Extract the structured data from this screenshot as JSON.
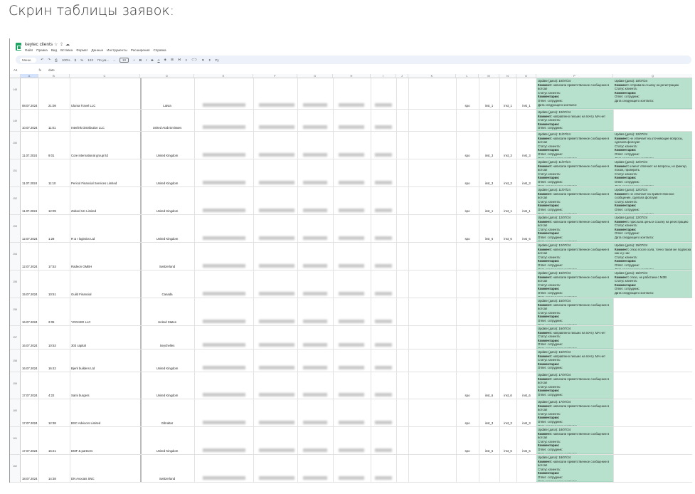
{
  "heading": "Скрин таблицы заявок:",
  "app": {
    "title": "keytec clients",
    "icons": [
      "star-icon",
      "move-icon",
      "cloud-icon"
    ],
    "menu": [
      "Файл",
      "Правка",
      "Вид",
      "Вставка",
      "Формат",
      "Данные",
      "Инструменты",
      "Расширения",
      "Справка"
    ],
    "toolbar": {
      "search": "Меню",
      "zoom": "100%",
      "number_format": "123",
      "font": "По ум...",
      "font_size": "10"
    },
    "name_box": "A1",
    "formula": "date"
  },
  "columns": [
    "A",
    "B",
    "C",
    "D",
    "E",
    "F",
    "G",
    "H",
    "I",
    "J",
    "K",
    "L",
    "M",
    "N",
    "O",
    "P",
    "Q"
  ],
  "labels": {
    "update": "Update (дата):",
    "comment": "Коммент:",
    "status": "Статус клиента:",
    "comments": "Комментарии:",
    "resp": "Ответ. сотрудник:",
    "next": "Дата следующего контакта:"
  },
  "rows": [
    {
      "n": "148",
      "date": "08.07.2024",
      "time": "21:08",
      "company": "Ulama Travel LLC",
      "country": "Latvia",
      "l": [
        "spo",
        "inst_1",
        "inst_1",
        "inst_1"
      ],
      "p": {
        "d": "10/07/24",
        "c": "написали приветственное сообщение в вотсап"
      },
      "q": {
        "d": "10/07/24",
        "c": "отправила ссылку на регистрацию"
      }
    },
    {
      "n": "149",
      "date": "10.07.2024",
      "time": "11:01",
      "company": "Interlink Distribution LLC",
      "country": "United Arab Emirates",
      "l": null,
      "p": {
        "d": "10/07/24",
        "c": "направлено письмо на почту. МА нет"
      },
      "q": null
    },
    {
      "n": "150",
      "date": "11.07.2024",
      "time": "9:01",
      "company": "Core international group ltd",
      "country": "United Kingdom",
      "l": [
        "spo",
        "inst_3",
        "inst_3",
        "inst_3"
      ],
      "p": {
        "d": "11/07/24",
        "c": "написали приветственное сообщение в вотсап"
      },
      "q": {
        "d": "12/07/24",
        "c": "не отвечает на уточняющие вопросы, сделала фолоуап"
      }
    },
    {
      "n": "151",
      "date": "11.07.2024",
      "time": "11:10",
      "company": "Pericol Financial Services Limited",
      "country": "United Kingdom",
      "l": [
        "spo",
        "inst_3",
        "inst_3",
        "inst_3"
      ],
      "p": {
        "d": "11/07/24",
        "c": "написали приветственное сообщение в вотсап"
      },
      "q": {
        "d": "12/07/24",
        "c": "клиент отвечает на вопросы, но фингер, похож, проверить"
      }
    },
    {
      "n": "152",
      "date": "11.07.2024",
      "time": "12:09",
      "company": "Zobsel UK Limited",
      "country": "United Kingdom",
      "l": [
        "spo",
        "inst_1",
        "inst_1",
        "inst_1"
      ],
      "p": {
        "d": "11/07/24",
        "c": "написали приветственное сообщение в вотсап"
      },
      "q": {
        "d": "12/07/24",
        "c": "не отвечает на приветственное сообщение, сделала фолоуап"
      }
    },
    {
      "n": "153",
      "date": "12.07.2024",
      "time": "1:28",
      "company": "R & I logistics Ltd",
      "country": "United Kingdom",
      "l": [
        "spo",
        "inst_6",
        "inst_6",
        "inst_6"
      ],
      "p": {
        "d": "12/07/24",
        "c": "написали приветственное сообщение в вотсап"
      },
      "q": {
        "d": "12/07/24",
        "c": "прислала цены и ссылку на регистрацию"
      }
    },
    {
      "n": "154",
      "date": "12.07.2024",
      "time": "17:53",
      "company": "Radeon GMBH",
      "country": "Switzerland",
      "l": null,
      "p": {
        "d": "12/07/24",
        "c": "написали приветственное сообщение в вотсап"
      },
      "q": {
        "d": "15/07/24",
        "c": "отказ после хола, точно такая же подписка как и у нас"
      }
    },
    {
      "n": "155",
      "date": "15.07.2024",
      "time": "10:51",
      "company": "Guild Financial",
      "country": "Canada",
      "l": null,
      "p": {
        "d": "15/07/24",
        "c": "написали приветственное сообщение в вотсап"
      },
      "q": {
        "d": "15/07/24",
        "c": "отказ, не работаем с МЗВ"
      }
    },
    {
      "n": "156",
      "date": "16.07.2024",
      "time": "2:05",
      "company": "YOGAED LLC",
      "country": "United States",
      "l": null,
      "p": {
        "d": "15/07/24",
        "c": "написали приветственное сообщение в вотсап"
      },
      "q": null
    },
    {
      "n": "157",
      "date": "16.07.2024",
      "time": "10:53",
      "company": "303 capital",
      "country": "Seychelles",
      "l": null,
      "p": {
        "d": "16/07/24",
        "c": "направлено письмо на почту. МА нет"
      },
      "q": null
    },
    {
      "n": "158",
      "date": "16.07.2024",
      "time": "16:42",
      "company": "Bjerk builders Ltd",
      "country": "United Kingdom",
      "l": null,
      "p": {
        "d": "16/07/24",
        "c": "направлено письмо на почту. МА нет"
      },
      "q": null
    },
    {
      "n": "159",
      "date": "17.07.2024",
      "time": "4:22",
      "company": "Sami burgers",
      "country": "United Kingdom",
      "l": [
        "spo",
        "inst_6",
        "inst_6",
        "inst_6"
      ],
      "p": {
        "d": "17/07/24",
        "c": "написали приветственное сообщение в вотсап"
      },
      "q": null
    },
    {
      "n": "160",
      "date": "17.07.2024",
      "time": "12:38",
      "company": "BSC Advisors Limited",
      "country": "Gibraltar",
      "l": [
        "spo",
        "inst_3",
        "inst_3",
        "inst_3"
      ],
      "p": {
        "d": "17/07/24",
        "c": "написали приветственное сообщение в вотсап"
      },
      "q": null
    },
    {
      "n": "161",
      "date": "17.07.2024",
      "time": "16:21",
      "company": "DMF & partners",
      "country": "United Kingdom",
      "l": [
        "spo",
        "inst_6",
        "inst_6",
        "inst_6"
      ],
      "p": {
        "d": "18/07/24",
        "c": "написали приветственное сообщение в вотсап"
      },
      "q": null
    },
    {
      "n": "162",
      "date": "18.07.2024",
      "time": "14:38",
      "company": "DN Avocats SNC",
      "country": "Switzerland",
      "l": null,
      "p": {
        "d": "18/07/24",
        "c": "написали приветственное сообщение в вотсап"
      },
      "q": null
    }
  ]
}
